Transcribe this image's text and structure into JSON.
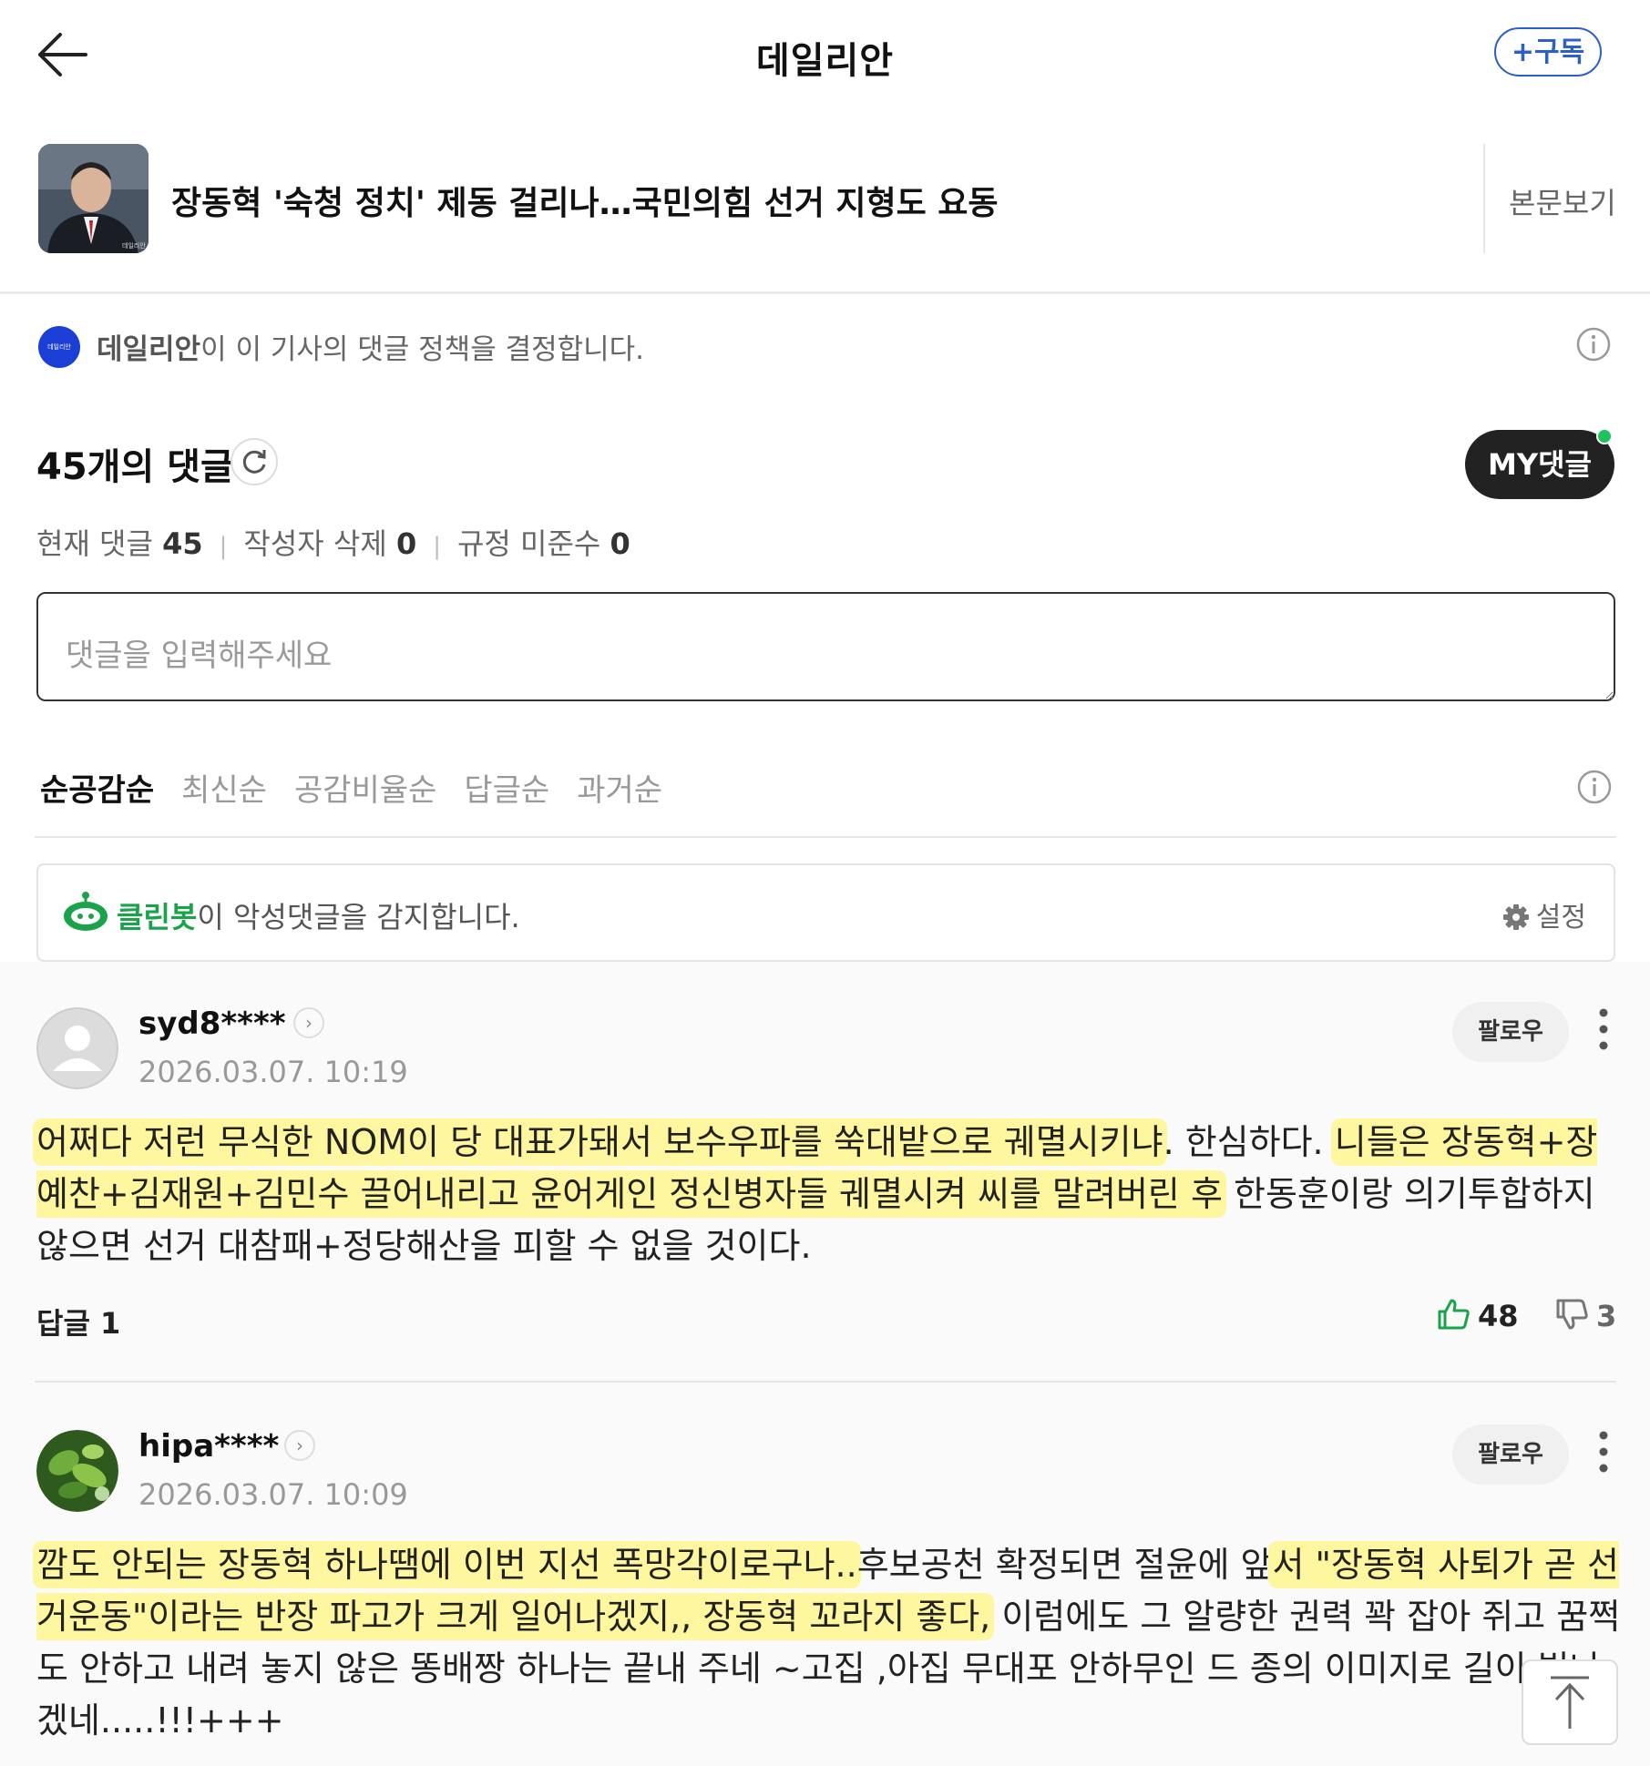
{
  "header": {
    "title": "데일리안",
    "subscribe_label": "+구독"
  },
  "article": {
    "title": "장동혁 '숙청 정치' 제동 걸리나…국민의힘 선거 지형도 요동",
    "view_article_label": "본문보기",
    "thumbnail_caption": "데일리안"
  },
  "policy": {
    "press_name": "데일리안",
    "text": "이 이 기사의 댓글 정책을 결정합니다.",
    "logo_text": "데일리안 NEWS"
  },
  "comments_summary": {
    "count_number": "45",
    "count_suffix": "개의 댓글",
    "my_comments_label": "MY댓글",
    "stats": [
      {
        "label": "현재 댓글",
        "value": "45"
      },
      {
        "label": "작성자 삭제",
        "value": "0"
      },
      {
        "label": "규정 미준수",
        "value": "0"
      }
    ]
  },
  "comment_input": {
    "placeholder": "댓글을 입력해주세요"
  },
  "sort_tabs": [
    "순공감순",
    "최신순",
    "공감비율순",
    "답글순",
    "과거순"
  ],
  "cleanbot": {
    "name": "클린봇",
    "text": "이 악성댓글을 감지합니다.",
    "settings_label": "설정"
  },
  "comments": [
    {
      "username": "syd8****",
      "timestamp": "2026.03.07. 10:19",
      "follow_label": "팔로우",
      "body_parts": [
        {
          "text": "어쩌다 저런 무식한 NOM이 당 대표가돼서 보수우파를 쑥대밭으로 궤멸시키냐",
          "hl": true
        },
        {
          "text": ". 한심하다. ",
          "hl": false
        },
        {
          "text": "니들은 장동혁+장예찬+김재원+김민수 끌어내리고 윤어게인 정신병자들 궤멸시켜 씨를 말려버린 후",
          "hl": true
        },
        {
          "text": " 한동훈이랑 의기투합하지 않으면 선거 대참패+정당해산을 피할 수 없을 것이다.",
          "hl": false
        }
      ],
      "reply_label": "답글 1",
      "likes": "48",
      "dislikes": "3"
    },
    {
      "username": "hipa****",
      "timestamp": "2026.03.07. 10:09",
      "follow_label": "팔로우",
      "body_parts": [
        {
          "text": "깜도 안되는 장동혁 하나땜에 이번 지선 폭망각이로구나..",
          "hl": true
        },
        {
          "text": "후보공천 확정되면 절윤에 앞",
          "hl": false
        },
        {
          "text": "서 \"장동혁 사퇴가 곧 선거운동\"이라는 반장 파고가 크게 일어나겠지,, 장동혁 꼬라지 좋다,",
          "hl": true
        },
        {
          "text": " 이럼에도 그 알량한 권력 꽉 잡아 쥐고 꿈쩍도 안하고 내려 놓지 않은 똥배짱 하나는 끝내 주네 ~고집 ,아집 무대포 안하무인 드 종의 이미지로 길이 빛나겠네.....!!!+++",
          "hl": false
        }
      ]
    }
  ]
}
